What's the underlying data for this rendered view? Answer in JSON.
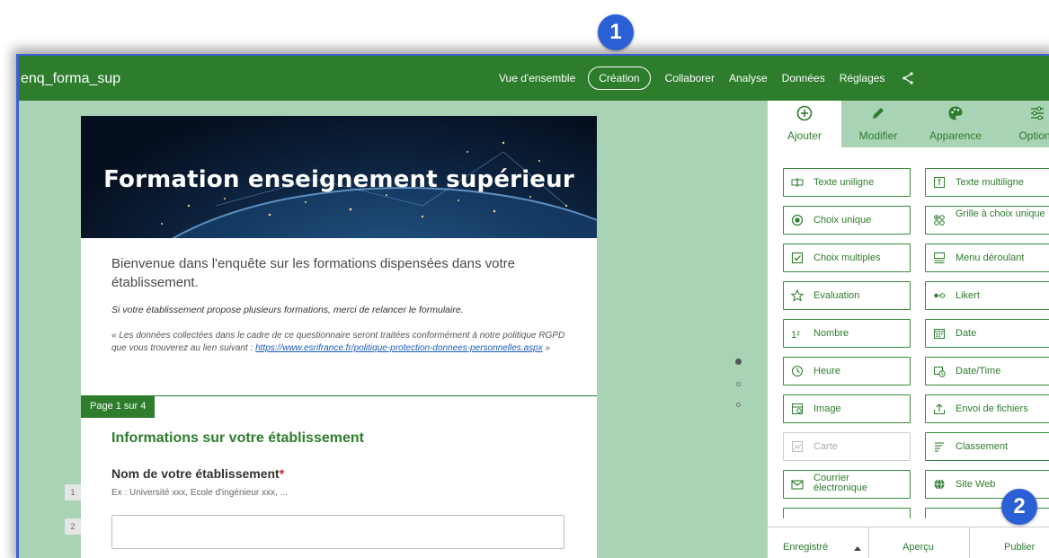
{
  "app": {
    "title": "enq_forma_sup"
  },
  "nav": {
    "items": [
      "Vue d'ensemble",
      "Création",
      "Collaborer",
      "Analyse",
      "Données",
      "Réglages"
    ],
    "active": "Création"
  },
  "form": {
    "banner_title": "Formation enseignement supérieur",
    "intro": "Bienvenue dans l'enquête sur les formations dispensées dans votre établissement.",
    "note": "Si votre établissement propose plusieurs formations, merci de relancer le formulaire.",
    "rgpd_prefix": "« Les données collectées dans le cadre de ce questionnaire seront traitées conformément à notre politique RGPD que vous trouverez au lien suivant : ",
    "rgpd_link": "https://www.esrifrance.fr/politique-protection-donnees-personnelles.aspx",
    "rgpd_suffix": " »",
    "page_label": "Page 1 sur 4",
    "q1_num": "1",
    "section_title": "Informations sur votre établissement",
    "q2_num": "2",
    "q2_title": "Nom de votre établissement",
    "q2_required": "*",
    "q2_hint": "Ex : Université xxx, Ecole d'ingénieur xxx, ..."
  },
  "panel": {
    "tabs": [
      {
        "label": "Ajouter",
        "icon": "add-circle-icon"
      },
      {
        "label": "Modifier",
        "icon": "pencil-icon"
      },
      {
        "label": "Apparence",
        "icon": "palette-icon"
      },
      {
        "label": "Options",
        "icon": "sliders-icon"
      }
    ],
    "active_tab": "Ajouter",
    "items": [
      {
        "label": "Texte uniligne",
        "icon": "single-line-text-icon"
      },
      {
        "label": "Texte multiligne",
        "icon": "multi-line-text-icon"
      },
      {
        "label": "Choix unique",
        "icon": "radio-icon"
      },
      {
        "label": "Grille à choix unique",
        "icon": "grid-choice-icon"
      },
      {
        "label": "Choix multiples",
        "icon": "checkbox-icon"
      },
      {
        "label": "Menu déroulant",
        "icon": "dropdown-icon"
      },
      {
        "label": "Evaluation",
        "icon": "star-icon"
      },
      {
        "label": "Likert",
        "icon": "likert-icon"
      },
      {
        "label": "Nombre",
        "icon": "number-icon"
      },
      {
        "label": "Date",
        "icon": "calendar-icon"
      },
      {
        "label": "Heure",
        "icon": "clock-icon"
      },
      {
        "label": "Date/Time",
        "icon": "calendar-clock-icon"
      },
      {
        "label": "Image",
        "icon": "image-icon"
      },
      {
        "label": "Envoi de fichiers",
        "icon": "upload-icon"
      },
      {
        "label": "Carte",
        "icon": "map-icon",
        "disabled": true
      },
      {
        "label": "Classement",
        "icon": "ranking-icon"
      },
      {
        "label": "Courrier électronique",
        "icon": "mail-icon"
      },
      {
        "label": "Site Web",
        "icon": "globe-icon"
      }
    ],
    "footer": {
      "saved": "Enregistré",
      "preview": "Aperçu",
      "publish": "Publier"
    }
  },
  "badges": {
    "one": "1",
    "two": "2"
  },
  "colors": {
    "accent": "#2d7d2d",
    "canvas": "#a9d3b5",
    "badge": "#2b5fd6"
  }
}
